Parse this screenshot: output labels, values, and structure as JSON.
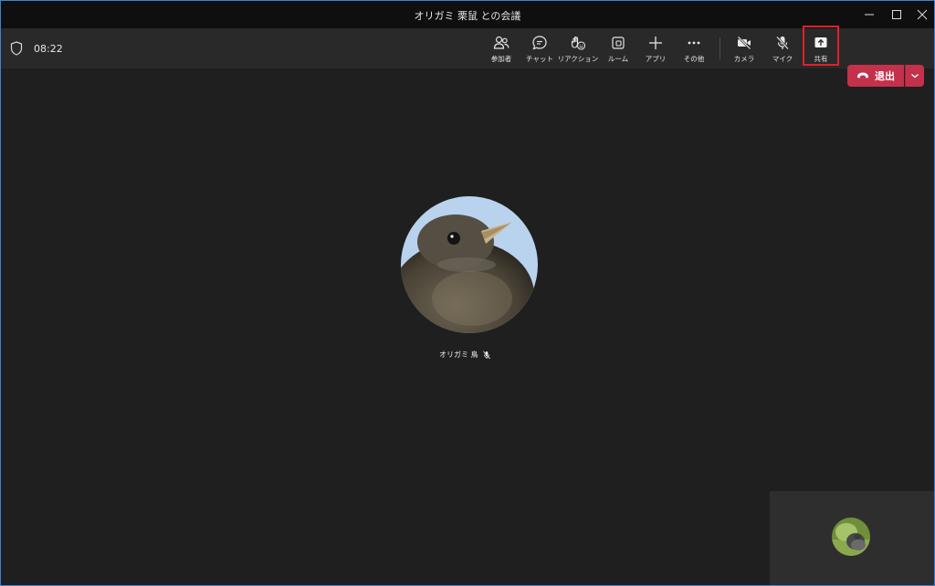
{
  "window": {
    "title": "オリガミ 栗鼠 との会議"
  },
  "toolbar": {
    "timer": "08:22",
    "participants_label": "参加者",
    "chat_label": "チャット",
    "reactions_label": "リアクション",
    "rooms_label": "ルーム",
    "apps_label": "アプリ",
    "more_label": "その他",
    "camera_label": "カメラ",
    "mic_label": "マイク",
    "share_label": "共有",
    "leave_label": "退出"
  },
  "stage": {
    "participant_name": "オリガミ 鳥"
  },
  "colors": {
    "leave": "#c4314b",
    "highlight": "#e0202a"
  }
}
